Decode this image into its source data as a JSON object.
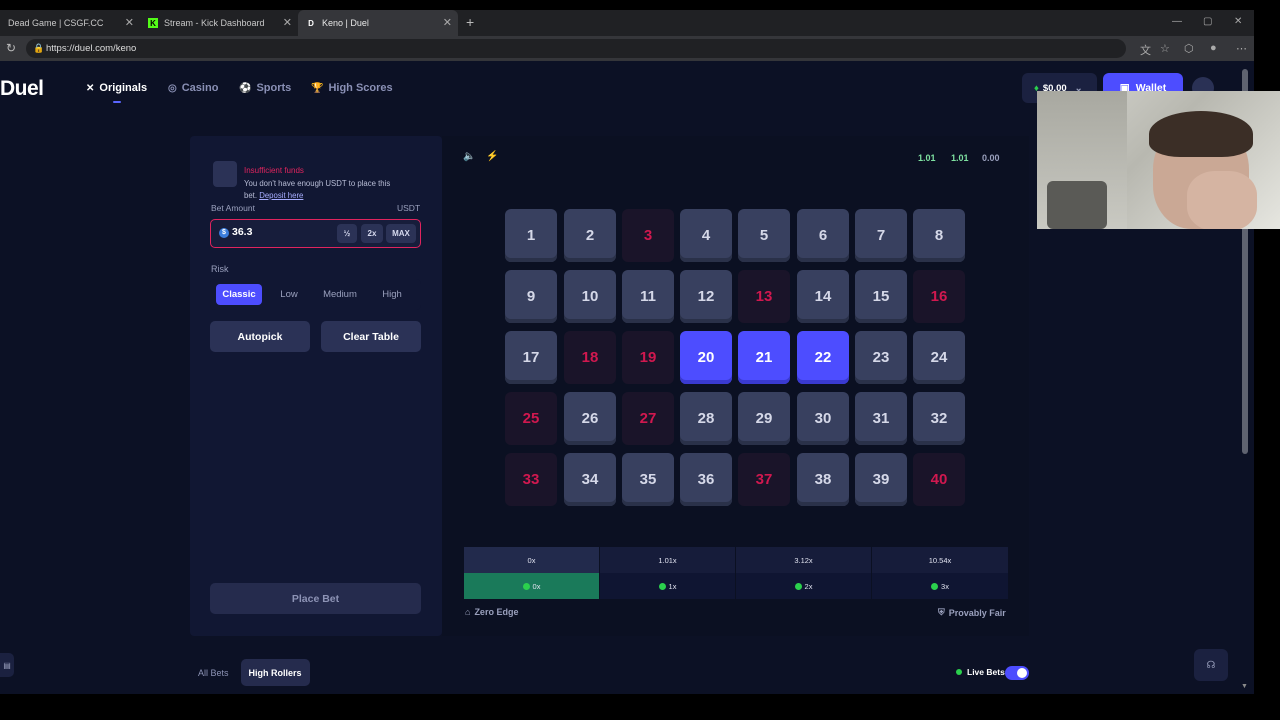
{
  "browser": {
    "tabs": [
      {
        "title": "Dead Game | CSGF.CC",
        "favicon": ""
      },
      {
        "title": "Stream - Kick Dashboard",
        "favicon": "K"
      },
      {
        "title": "Keno | Duel",
        "favicon": "D"
      }
    ],
    "new_tab": "+",
    "url": "https://duel.com/keno"
  },
  "nav": {
    "logo": "Duel",
    "items": [
      {
        "label": "Originals",
        "icon": "crossed-swords-icon"
      },
      {
        "label": "Casino",
        "icon": "chip-icon"
      },
      {
        "label": "Sports",
        "icon": "ball-icon"
      },
      {
        "label": "High Scores",
        "icon": "trophy-icon"
      }
    ],
    "balance": "$0.00",
    "wallet_label": "Wallet"
  },
  "bet_panel": {
    "error_title": "Insufficient funds",
    "error_message": "You don't have enough USDT to place this bet.",
    "error_link": "Deposit here",
    "bet_amount_label": "Bet Amount",
    "bet_unit": "USDT",
    "bet_value": "36.3",
    "half_label": "½",
    "double_label": "2x",
    "max_label": "MAX",
    "risk_label": "Risk",
    "risk_options": [
      "Classic",
      "Low",
      "Medium",
      "High"
    ],
    "risk_selected": "Classic",
    "autopick_label": "Autopick",
    "clear_label": "Clear Table",
    "place_bet_label": "Place Bet"
  },
  "game": {
    "stats": [
      "1.01",
      "1.01",
      "0.00"
    ],
    "tiles": [
      {
        "n": "1",
        "state": "normal"
      },
      {
        "n": "2",
        "state": "normal"
      },
      {
        "n": "3",
        "state": "miss"
      },
      {
        "n": "4",
        "state": "normal"
      },
      {
        "n": "5",
        "state": "normal"
      },
      {
        "n": "6",
        "state": "normal"
      },
      {
        "n": "7",
        "state": "normal"
      },
      {
        "n": "8",
        "state": "normal"
      },
      {
        "n": "9",
        "state": "normal"
      },
      {
        "n": "10",
        "state": "normal"
      },
      {
        "n": "11",
        "state": "normal"
      },
      {
        "n": "12",
        "state": "normal"
      },
      {
        "n": "13",
        "state": "miss"
      },
      {
        "n": "14",
        "state": "normal"
      },
      {
        "n": "15",
        "state": "normal"
      },
      {
        "n": "16",
        "state": "miss"
      },
      {
        "n": "17",
        "state": "normal"
      },
      {
        "n": "18",
        "state": "miss"
      },
      {
        "n": "19",
        "state": "miss"
      },
      {
        "n": "20",
        "state": "picked"
      },
      {
        "n": "21",
        "state": "picked"
      },
      {
        "n": "22",
        "state": "picked"
      },
      {
        "n": "23",
        "state": "normal"
      },
      {
        "n": "24",
        "state": "normal"
      },
      {
        "n": "25",
        "state": "miss"
      },
      {
        "n": "26",
        "state": "normal"
      },
      {
        "n": "27",
        "state": "miss"
      },
      {
        "n": "28",
        "state": "normal"
      },
      {
        "n": "29",
        "state": "normal"
      },
      {
        "n": "30",
        "state": "normal"
      },
      {
        "n": "31",
        "state": "normal"
      },
      {
        "n": "32",
        "state": "normal"
      },
      {
        "n": "33",
        "state": "miss"
      },
      {
        "n": "34",
        "state": "normal"
      },
      {
        "n": "35",
        "state": "normal"
      },
      {
        "n": "36",
        "state": "normal"
      },
      {
        "n": "37",
        "state": "miss"
      },
      {
        "n": "38",
        "state": "normal"
      },
      {
        "n": "39",
        "state": "normal"
      },
      {
        "n": "40",
        "state": "miss"
      }
    ],
    "payouts": [
      "0x",
      "1.01x",
      "3.12x",
      "10.54x"
    ],
    "hits": [
      "0x",
      "1x",
      "2x",
      "3x"
    ],
    "zero_edge_label": "Zero Edge",
    "provably_fair_label": "Provably Fair"
  },
  "bottom": {
    "tabs": [
      "All Bets",
      "High Rollers"
    ],
    "active_tab": "High Rollers",
    "live_bets_label": "Live Bets"
  },
  "colors": {
    "accent": "#4d4dff",
    "miss": "#d0184f",
    "win": "#2bd04d"
  }
}
